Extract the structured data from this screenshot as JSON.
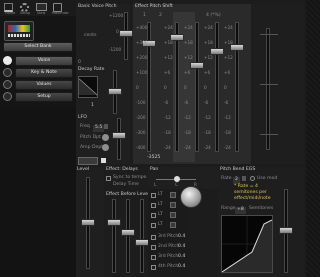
{
  "toolbar": {
    "icons": [
      {
        "name": "home-icon",
        "label": "Home"
      },
      {
        "name": "setup-icon",
        "label": "Setup"
      },
      {
        "name": "view-icon",
        "label": "View"
      },
      {
        "name": "maximize-icon",
        "label": "Maximize"
      }
    ]
  },
  "sidebar": {
    "items": [
      {
        "label": "Select Bank"
      },
      {
        "label": "Voice"
      },
      {
        "label": "Key & Note"
      },
      {
        "label": "Values"
      },
      {
        "label": "Setup"
      }
    ]
  },
  "voice_pitch": {
    "title": "Basic Voice Pitch",
    "cents_label": "cents",
    "scale": [
      "+1200",
      "0",
      "-1200"
    ],
    "readout": "0"
  },
  "decay": {
    "title": "Decay Rate",
    "value": "1"
  },
  "lfo": {
    "title": "LFO",
    "freq_label": "Freq",
    "freq_value": "5.5",
    "pitch_depth_label": "Pitch Dpt",
    "amp_depth_label": "Amp Depth",
    "trigger_label": "Trig In"
  },
  "pitch_shift": {
    "title": "Effect Pitch Shift",
    "tabs": [
      "1",
      "2",
      "3 (*%)",
      "4 (*%)"
    ],
    "lanes": [
      {
        "scale": [
          "+400",
          "+300",
          "+200",
          "+100",
          "0",
          "-100",
          "-200",
          "-300",
          "-400"
        ]
      },
      {
        "scale": [
          "+24",
          "+18",
          "+12",
          "+6",
          "0",
          "-6",
          "-12",
          "-18",
          "-24"
        ]
      },
      {
        "scale": [
          "+24",
          "+18",
          "+12",
          "+6",
          "0",
          "-6",
          "-12",
          "-18",
          "-24"
        ]
      },
      {
        "scale": [
          "+24",
          "+18",
          "+12",
          "+6",
          "0",
          "-6",
          "-12",
          "-18",
          "-24"
        ]
      },
      {
        "scale": [
          "+24",
          "+18",
          "+12",
          "+6",
          "0",
          "-6",
          "-12",
          "-18",
          "-24"
        ]
      }
    ],
    "readout": "-3525"
  },
  "level": {
    "title": "Level"
  },
  "delays": {
    "title": "Effect: Delays",
    "sync_label": "Sync to tempo",
    "delay_time_label": "Delay Time",
    "effect_level_title": "Effect Before Level",
    "items": [
      {
        "label": "LT"
      },
      {
        "label": "LT"
      },
      {
        "label": "LT"
      },
      {
        "label": "LT"
      }
    ],
    "harmonic_items": [
      {
        "label": "3rd Pitch",
        "value": "0.4"
      },
      {
        "label": "2nd Pitch",
        "value": "0.4"
      },
      {
        "label": "3rd Pitch",
        "value": "0.4"
      },
      {
        "label": "4th Pitch",
        "value": "0.4"
      }
    ]
  },
  "pan": {
    "title": "Pan",
    "scale": [
      "L",
      "C",
      "R"
    ]
  },
  "pitch_bend": {
    "title": "Pitch Bend EGS",
    "rate_label": "Rate",
    "rate_value": "2",
    "mode_label": "Use mod",
    "note": [
      "* Rate = 4",
      "semitones per",
      "effect/midi/note"
    ],
    "range_label": "Range",
    "range_value": "+8",
    "semitones_label": "Semitones"
  }
}
